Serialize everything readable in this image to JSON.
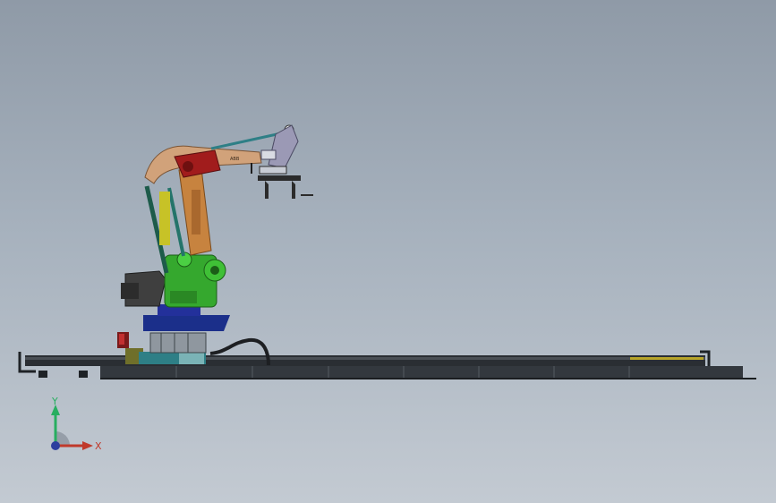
{
  "viewport": {
    "background_top": "#8f9aa7",
    "background_bottom": "#c3cad2"
  },
  "model": {
    "parts": [
      "robot-base",
      "robot-turret",
      "lower-arm",
      "upper-arm",
      "counterweight",
      "wrist",
      "gripper",
      "parallel-link",
      "linear-track",
      "cable-chain"
    ],
    "colors": {
      "turret": "#35a82e",
      "lower_arm": "#c7833f",
      "upper_arm": "#d1a27a",
      "joint_red": "#a11c1c",
      "base_plate": "#1b2f8a",
      "track": "#2a2e33",
      "link_teal": "#2e7f86",
      "counterweight": "#3f3f3f",
      "track_stripe": "#b8a52a"
    }
  },
  "triad": {
    "x_label": "X",
    "y_label": "Y",
    "icon": "coordinate-triad-icon",
    "x_color": "#c0392b",
    "y_color": "#27ae60",
    "z_color": "#2c3e9e"
  }
}
